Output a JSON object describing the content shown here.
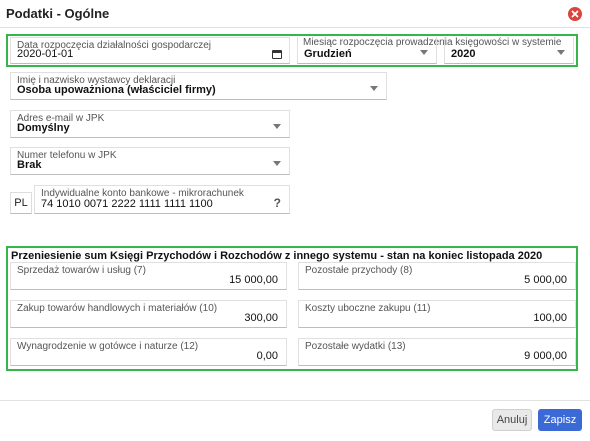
{
  "window": {
    "title": "Podatki - Ogólne"
  },
  "fields": {
    "start_date": {
      "label": "Data rozpoczęcia działalności gospodarczej",
      "value": "2020-01-01"
    },
    "start_month": {
      "label": "Miesiąc rozpoczęcia prowadzenia księgowości w systemie",
      "month": "Grudzień",
      "year": "2020"
    },
    "issuer": {
      "label": "Imię i nazwisko wystawcy deklaracji",
      "value": "Osoba upoważniona (właściciel firmy)"
    },
    "email": {
      "label": "Adres e-mail w JPK",
      "value": "Domyślny"
    },
    "phone": {
      "label": "Numer telefonu w JPK",
      "value": "Brak"
    },
    "account": {
      "prefix": "PL",
      "label": "Indywidualne konto bankowe - mikrorachunek",
      "value": "74 1010 0071 2222 1111 1111 1100",
      "help": "?"
    }
  },
  "transfer": {
    "title": "Przeniesienie sum Księgi Przychodów i Rozchodów z innego systemu - stan na koniec listopada 2020",
    "items": [
      {
        "label": "Sprzedaż towarów i usług (7)",
        "value": "15 000,00"
      },
      {
        "label": "Pozostałe przychody (8)",
        "value": "5 000,00"
      },
      {
        "label": "Zakup towarów handlowych i materiałów (10)",
        "value": "300,00"
      },
      {
        "label": "Koszty uboczne zakupu (11)",
        "value": "100,00"
      },
      {
        "label": "Wynagrodzenie w gotówce i naturze (12)",
        "value": "0,00"
      },
      {
        "label": "Pozostałe wydatki (13)",
        "value": "9 000,00"
      }
    ]
  },
  "buttons": {
    "cancel": "Anuluj",
    "save": "Zapisz"
  },
  "colors": {
    "highlight": "#38b54a",
    "primary": "#3b6ad6",
    "close": "#d9453d"
  }
}
